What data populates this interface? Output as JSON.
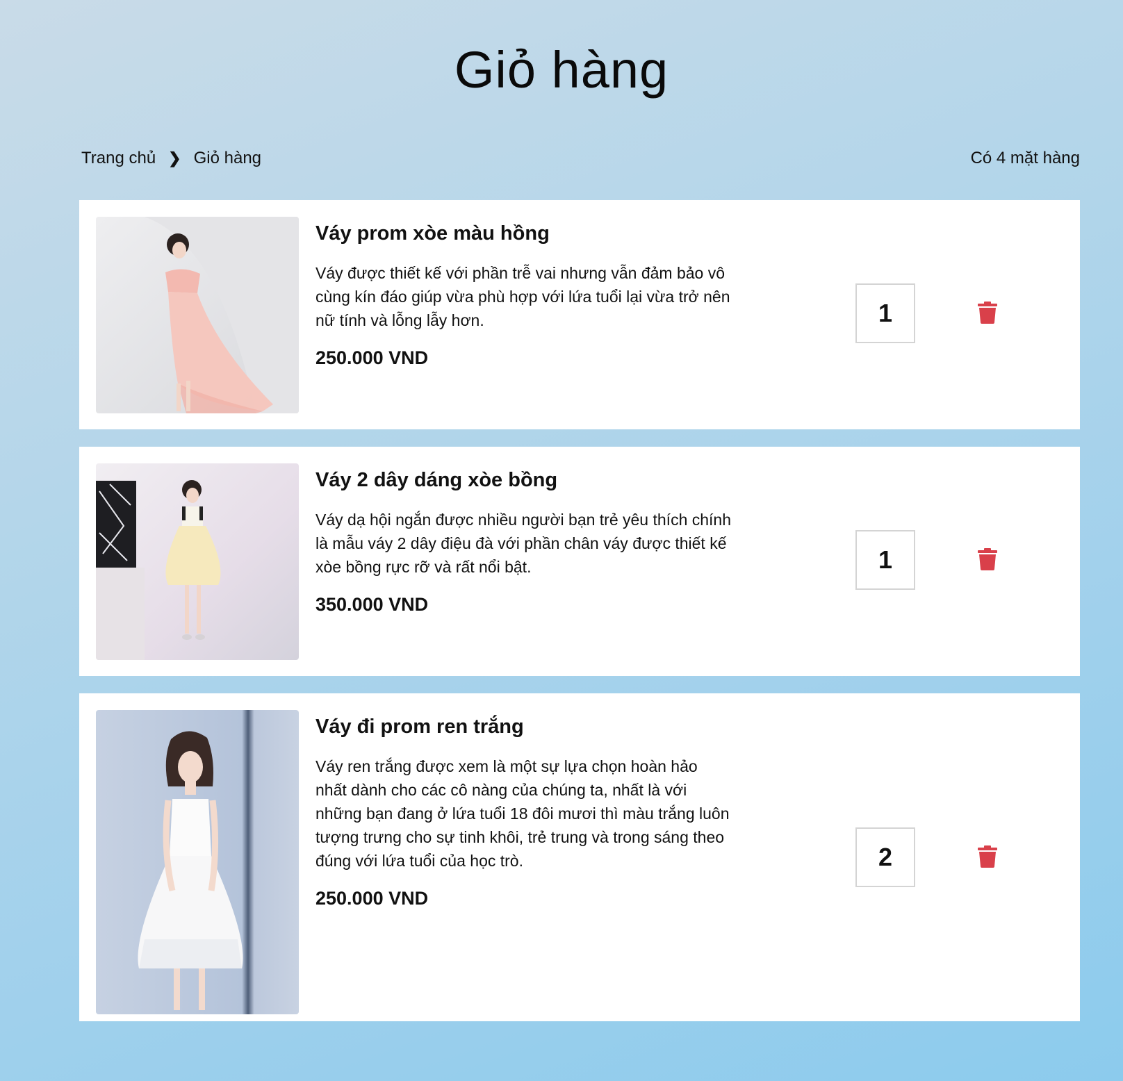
{
  "page": {
    "title": "Giỏ hàng"
  },
  "breadcrumb": {
    "home": "Trang chủ",
    "separator": "❯",
    "current": "Giỏ hàng"
  },
  "summary": {
    "item_count_text": "Có 4 mặt hàng"
  },
  "colors": {
    "delete_icon": "#d9404a",
    "card_bg": "#ffffff",
    "qty_border": "#d4d4d4"
  },
  "cart": {
    "items": [
      {
        "name": "Váy prom xòe màu hồng",
        "description": "Váy được thiết kế với phần trễ vai nhưng vẫn đảm bảo vô cùng kín đáo giúp vừa phù hợp với lứa tuổi lại vừa trở nên nữ tính và lỗng lẫy hơn.",
        "price": "250.000 VND",
        "quantity": "1",
        "image_icon": "product-photo-pink-dress"
      },
      {
        "name": "Váy 2 dây dáng xòe bồng",
        "description": "Váy dạ hội ngắn được nhiều người bạn trẻ yêu thích chính là mẫu váy 2 dây điệu đà với phần chân váy được thiết kế xòe bồng rực rỡ và rất nổi bật.",
        "price": "350.000 VND",
        "quantity": "1",
        "image_icon": "product-photo-yellow-dress"
      },
      {
        "name": "Váy đi prom ren trắng",
        "description": "Váy ren trắng được xem là một sự lựa chọn hoàn hảo nhất dành cho các cô nàng của chúng ta, nhất là với những bạn đang ở lứa tuổi 18 đôi mươi thì màu trắng luôn tượng trưng cho sự tinh khôi, trẻ trung và trong sáng theo đúng với lứa tuổi của học trò.",
        "price": "250.000 VND",
        "quantity": "2",
        "image_icon": "product-photo-white-dress"
      }
    ]
  }
}
